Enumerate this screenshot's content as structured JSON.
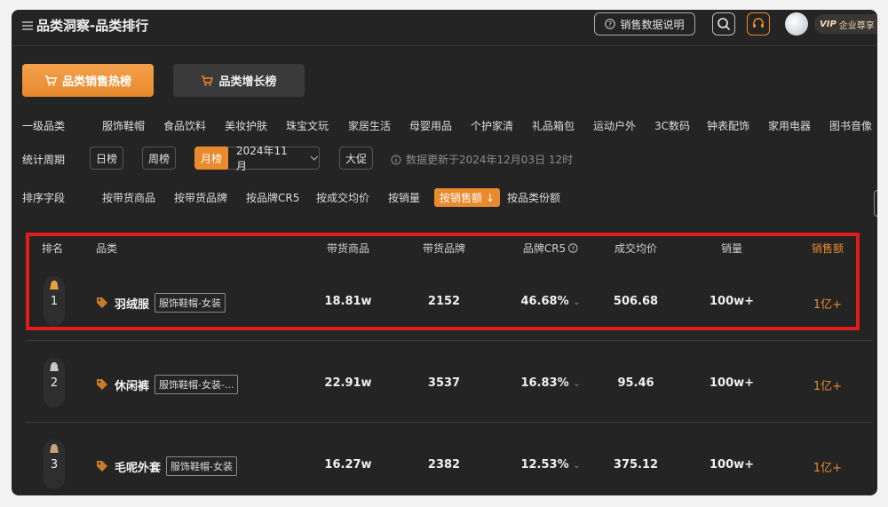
{
  "header": {
    "title": "品类洞察-品类排行",
    "explain_label": "销售数据说明",
    "vip_label": "VIP",
    "vip_text": "企业尊享"
  },
  "tabs": [
    {
      "label": "品类销售热榜"
    },
    {
      "label": "品类增长榜"
    }
  ],
  "filters": {
    "category_label": "一级品类",
    "categories": [
      "服饰鞋帽",
      "食品饮料",
      "美妆护肤",
      "珠宝文玩",
      "家居生活",
      "母婴用品",
      "个护家清",
      "礼品箱包",
      "运动户外",
      "3C数码",
      "钟表配饰",
      "家用电器",
      "图书音像"
    ],
    "period_label": "统计周期",
    "periods": [
      "日榜",
      "周榜",
      "月榜",
      "大促"
    ],
    "month_value": "2024年11月",
    "update_note": "数据更新于2024年12月03日 12时",
    "sort_label": "排序字段",
    "sort_options": [
      "按带货商品",
      "按带货品牌",
      "按品牌CR5",
      "按成交均价",
      "按销量",
      "按销售额",
      "按品类份额"
    ]
  },
  "table": {
    "headers": [
      "排名",
      "品类",
      "带货商品",
      "带货品牌",
      "品牌CR5",
      "成交均价",
      "销量",
      "销售额"
    ],
    "rows": [
      {
        "rank": "1",
        "name": "羽绒服",
        "badge": "服饰鞋帽-女装",
        "products": "18.81w",
        "brands": "2152",
        "cr5": "46.68%",
        "avg_price": "506.68",
        "volume": "100w+",
        "sales": "1亿+"
      },
      {
        "rank": "2",
        "name": "休闲裤",
        "badge": "服饰鞋帽-女装-...",
        "products": "22.91w",
        "brands": "3537",
        "cr5": "16.83%",
        "avg_price": "95.46",
        "volume": "100w+",
        "sales": "1亿+"
      },
      {
        "rank": "3",
        "name": "毛呢外套",
        "badge": "服饰鞋帽-女装",
        "products": "16.27w",
        "brands": "2382",
        "cr5": "12.53%",
        "avg_price": "375.12",
        "volume": "100w+",
        "sales": "1亿+"
      }
    ]
  },
  "colors": {
    "accent": "#e88a2d",
    "background": "#242424",
    "highlight": "#e21b1b"
  }
}
